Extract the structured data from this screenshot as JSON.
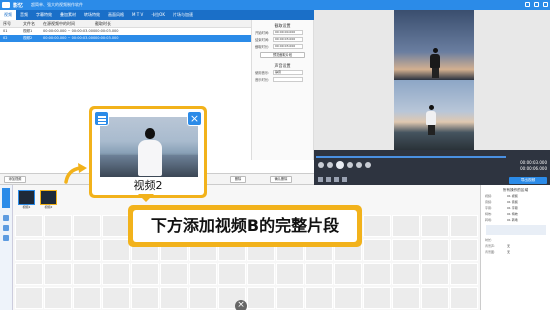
{
  "titlebar": {
    "app_name": "影忆",
    "subtitle": "超简单、强大的视频制作软件"
  },
  "menubar": {
    "items": [
      "视频",
      "音频",
      "字幕特效",
      "叠加素材",
      "转场特效",
      "画面风格",
      "M T V",
      "卡拉OK",
      "片场与加速"
    ]
  },
  "table": {
    "headers": [
      "序号",
      "文件名",
      "在源视频中的时间",
      "截取时长"
    ],
    "rows": [
      [
        "01",
        "视频1",
        "00:00:00.000 ~ 00:00:03.000",
        "00:00:03.000"
      ],
      [
        "02",
        "视频2",
        "00:00:00.000 ~ 00:00:03.000",
        "00:00:03.000"
      ]
    ]
  },
  "settings": {
    "title": "截取设置",
    "rows": [
      {
        "label": "开始时间:",
        "value": "00:00:00.000"
      },
      {
        "label": "结束时间:",
        "value": "00:00:03.000"
      },
      {
        "label": "截取时长:",
        "value": "00:00:03.000"
      }
    ],
    "preview_button": "预览截取片段",
    "title2": "声音设置",
    "rows2": [
      {
        "label": "使用音乐:",
        "value": "静音"
      },
      {
        "label": "音乐时长:",
        "value": ""
      }
    ]
  },
  "playback": {
    "time_current": "00:00:03.000",
    "time_total": "00:00:06.000",
    "export_label": "导出视频"
  },
  "timeline_toolbar": {
    "add_label": "添加视频",
    "delete_label": "删除",
    "clear_label": "确认删除"
  },
  "timeline": {
    "side_label": "已添加的视频",
    "clips": [
      {
        "label": "视频1"
      },
      {
        "label": "视频2"
      }
    ]
  },
  "props_panel": {
    "title": "所有操作的区域",
    "rows": [
      {
        "label": "视频:",
        "value": "01 视频"
      },
      {
        "label": "音频:",
        "value": "01 音频"
      },
      {
        "label": "字幕:",
        "value": "01 字幕"
      },
      {
        "label": "特效:",
        "value": "01 特效"
      },
      {
        "label": "转场:",
        "value": "01 转场"
      },
      {
        "label": "时长:",
        "value": ""
      },
      {
        "label": "背景声:",
        "value": "无"
      },
      {
        "label": "背景图:",
        "value": "无"
      }
    ]
  },
  "popup": {
    "label": "视频2"
  },
  "callout": {
    "text": "下方添加视频B的完整片段"
  },
  "colors": {
    "accent": "#2b8be8",
    "highlight": "#f2b21b"
  }
}
